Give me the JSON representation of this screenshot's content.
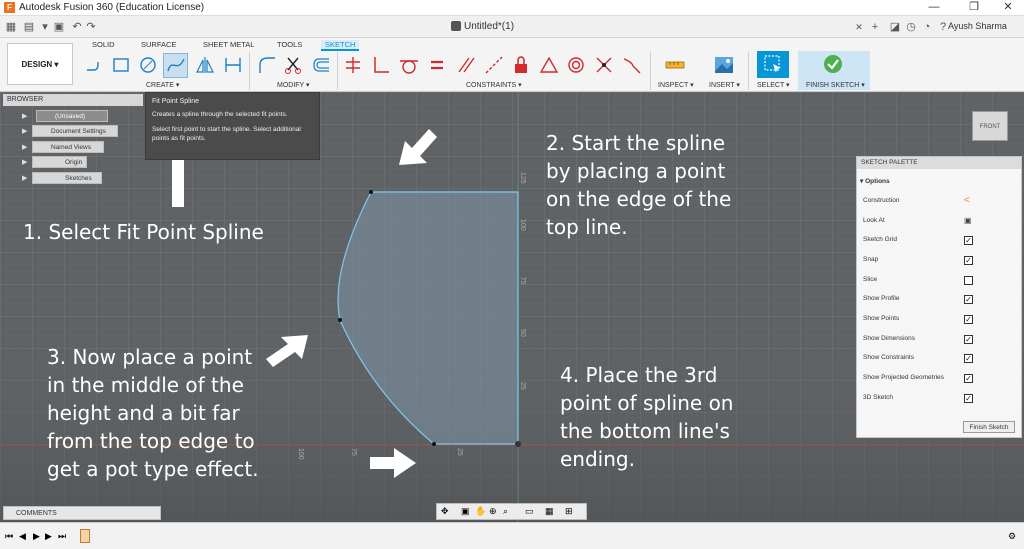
{
  "window": {
    "title": "Autodesk Fusion 360 (Education License)",
    "logo": "F",
    "controls": [
      "—",
      "❐",
      "✕"
    ]
  },
  "doc": {
    "tab_title": "Untitled*(1)",
    "user": "Ayush Sharma"
  },
  "ribbon": {
    "workspace": "DESIGN ▾",
    "tabs": [
      "SOLID",
      "SURFACE",
      "SHEET METAL",
      "TOOLS",
      "SKETCH"
    ],
    "active_tab": "SKETCH",
    "groups": {
      "create": "CREATE ▾",
      "modify": "MODIFY ▾",
      "constraints": "CONSTRAINTS ▾",
      "inspect": "INSPECT ▾",
      "insert": "INSERT ▾",
      "select": "SELECT ▾",
      "finish": "FINISH SKETCH ▾"
    }
  },
  "tooltip": {
    "title": "Fit Point Spline",
    "line1": "Creates a spline through the selected fit points.",
    "line2": "Select first point to start the spline. Select additional points as fit points."
  },
  "browser": {
    "header": "BROWSER",
    "items": [
      {
        "label": "(Unsaved)"
      },
      {
        "label": "Document Settings"
      },
      {
        "label": "Named Views"
      },
      {
        "label": "Origin"
      },
      {
        "label": "Sketches"
      }
    ]
  },
  "palette": {
    "header": "SKETCH PALETTE",
    "section": "Options",
    "rows": [
      {
        "label": "Construction",
        "state": "icon"
      },
      {
        "label": "Look At",
        "state": "icon"
      },
      {
        "label": "Sketch Grid",
        "state": "checked"
      },
      {
        "label": "Snap",
        "state": "checked"
      },
      {
        "label": "Slice",
        "state": "unchecked"
      },
      {
        "label": "Show Profile",
        "state": "checked"
      },
      {
        "label": "Show Points",
        "state": "checked"
      },
      {
        "label": "Show Dimensions",
        "state": "checked"
      },
      {
        "label": "Show Constraints",
        "state": "checked"
      },
      {
        "label": "Show Projected Geometries",
        "state": "checked"
      },
      {
        "label": "3D Sketch",
        "state": "checked"
      }
    ],
    "finish_button": "Finish Sketch"
  },
  "viewcube": {
    "face": "FRONT"
  },
  "instructions": {
    "step1": [
      "1. Select Fit Point Spline"
    ],
    "step2": [
      "2. Start the spline",
      "by placing a point",
      "on the edge of the",
      "top line."
    ],
    "step3": [
      "3. Now place a point",
      "in the middle of the",
      "height and a bit far",
      "from the top edge to",
      "get a pot type effect."
    ],
    "step4": [
      "4. Place the 3rd",
      "point of spline on",
      "the bottom line's",
      "ending."
    ]
  },
  "dimensions": {
    "vertical_ticks": [
      "125",
      "100",
      "75",
      "50",
      "25"
    ],
    "horizontal_ticks": [
      "100",
      "75",
      "25"
    ]
  },
  "bottom": {
    "comments": "COMMENTS"
  },
  "colors": {
    "accent": "#0696d7",
    "finish_green": "#4caf50",
    "sketch_line": "#7ec8f0",
    "profile_fill": "#7e96a8",
    "constraint_red": "#d12b2b"
  }
}
